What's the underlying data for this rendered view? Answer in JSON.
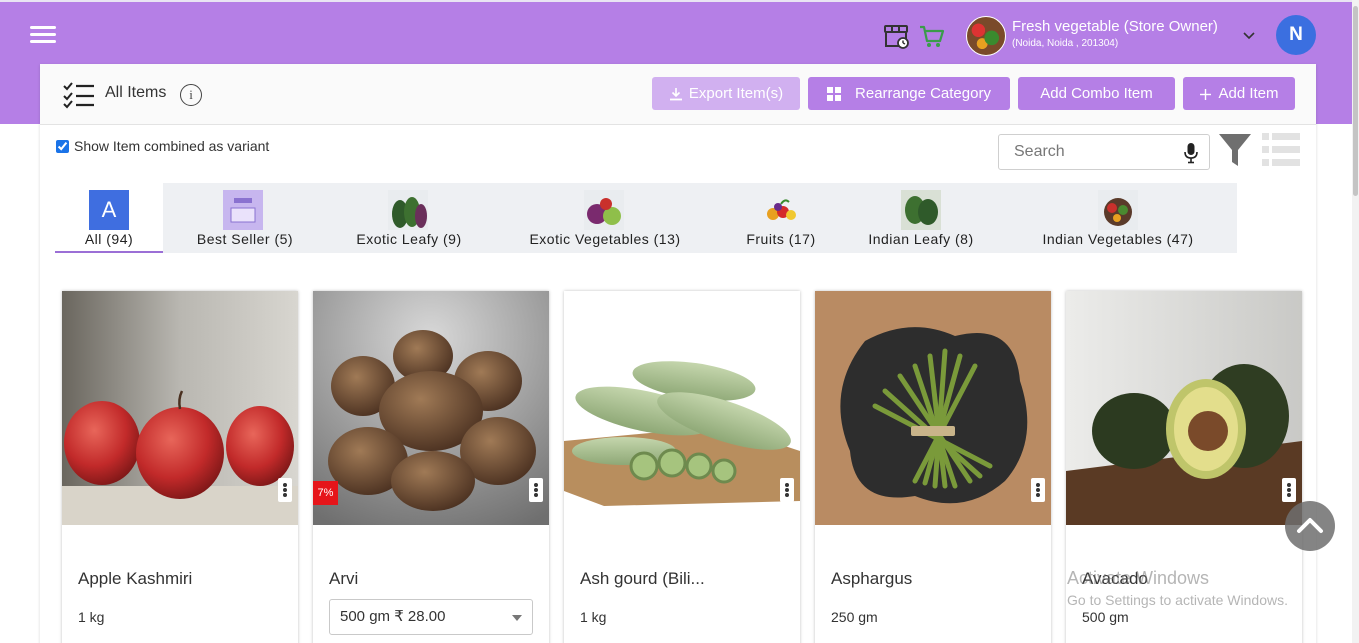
{
  "header": {
    "store_name": "Fresh vegetable (Store Owner)",
    "store_location": "(Noida, Noida , 201304)",
    "user_initial": "N",
    "bg_color": "#b57fe6"
  },
  "toolbar": {
    "title": "All Items",
    "info_symbol": "i",
    "export_label": "Export Item(s)",
    "rearrange_label": "Rearrange Category",
    "combo_label": "Add Combo Item",
    "add_label": "Add Item"
  },
  "filters": {
    "variant_label": "Show Item combined as variant",
    "variant_checked": true,
    "search_placeholder": "Search"
  },
  "categories": [
    {
      "label": "All (94)",
      "thumb_letter": "A",
      "active": true
    },
    {
      "label": "Best Seller (5)"
    },
    {
      "label": "Exotic Leafy (9)"
    },
    {
      "label": "Exotic Vegetables (13)"
    },
    {
      "label": "Fruits (17)"
    },
    {
      "label": "Indian Leafy (8)"
    },
    {
      "label": "Indian Vegetables (47)"
    }
  ],
  "products": [
    {
      "name": "Apple Kashmiri",
      "qty": "1 kg"
    },
    {
      "name": "Arvi",
      "discount": "7%",
      "variant": "500 gm ₹ 28.00"
    },
    {
      "name": "Ash gourd (Bili...",
      "qty": "1 kg"
    },
    {
      "name": "Asphargus",
      "qty": "250 gm"
    },
    {
      "name": "Avacado",
      "qty": "500 gm"
    }
  ],
  "watermark": {
    "line1": "Activate Windows",
    "line2": "Go to Settings to activate Windows."
  }
}
